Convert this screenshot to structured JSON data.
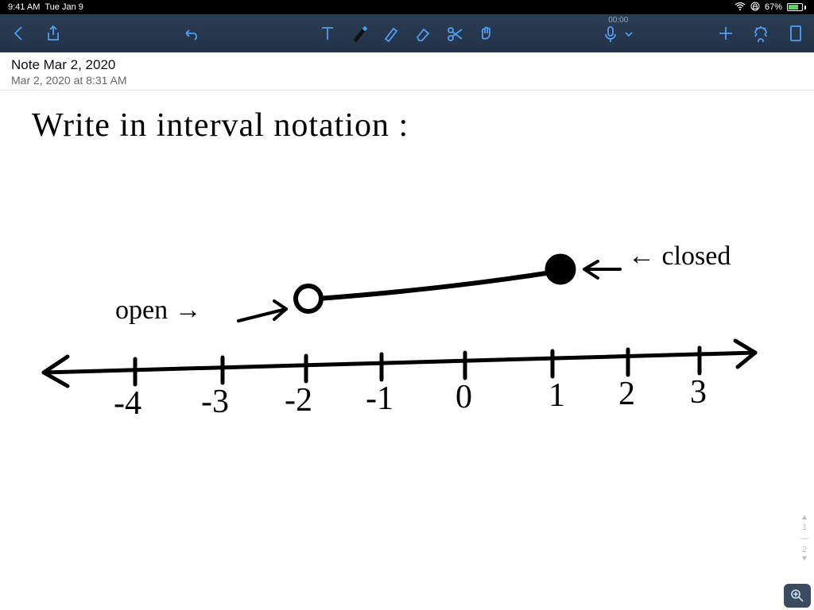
{
  "status": {
    "time": "9:41 AM",
    "date": "Tue Jan 9",
    "battery_pct": "67%",
    "rec_time": "00:00"
  },
  "note": {
    "title": "Note Mar 2, 2020",
    "subtitle": "Mar 2, 2020 at 8:31 AM"
  },
  "handwriting": {
    "prompt": "Write  in  interval  notation :",
    "open_label": "open",
    "closed_label": "closed"
  },
  "numberline": {
    "ticks": [
      "-4",
      "-3",
      "-2",
      "-1",
      "0",
      "1",
      "2",
      "3"
    ],
    "open_at": -2,
    "closed_at": 1
  },
  "pager": {
    "current": "1",
    "total": "2"
  },
  "colors": {
    "toolbar_bg": "#243549",
    "accent": "#4f9ff2"
  }
}
